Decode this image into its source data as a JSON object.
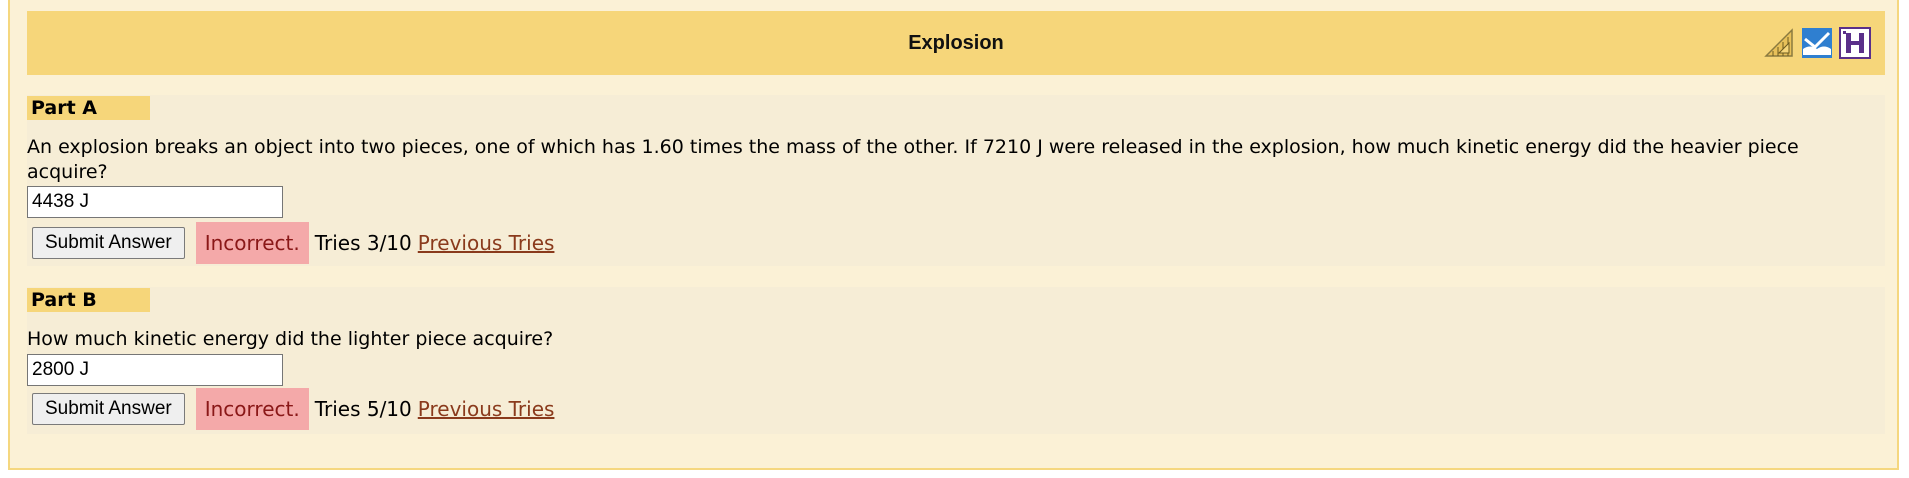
{
  "problem": {
    "title": "Explosion",
    "icons": [
      "feedback-triangle-icon",
      "discussion-book-icon",
      "help-h-icon"
    ]
  },
  "parts": [
    {
      "label": "Part A",
      "question": "An explosion breaks an object into two pieces, one of which has 1.60 times the mass of the other. If 7210 J were released in the explosion, how much kinetic energy did the heavier piece acquire?",
      "answer_value": "4438 J",
      "submit_label": "Submit Answer",
      "status": "Incorrect.",
      "tries": "Tries 3/10",
      "previous_tries_label": "Previous Tries"
    },
    {
      "label": "Part B",
      "question": "How much kinetic energy did the lighter piece acquire?",
      "answer_value": "2800 J",
      "submit_label": "Submit Answer",
      "status": "Incorrect.",
      "tries": "Tries 5/10",
      "previous_tries_label": "Previous Tries"
    }
  ],
  "colors": {
    "title_bar": "#f6d67a",
    "panel": "#fbf1d6",
    "incorrect_bg": "#f4a9a9",
    "link": "#8a3a1c"
  }
}
